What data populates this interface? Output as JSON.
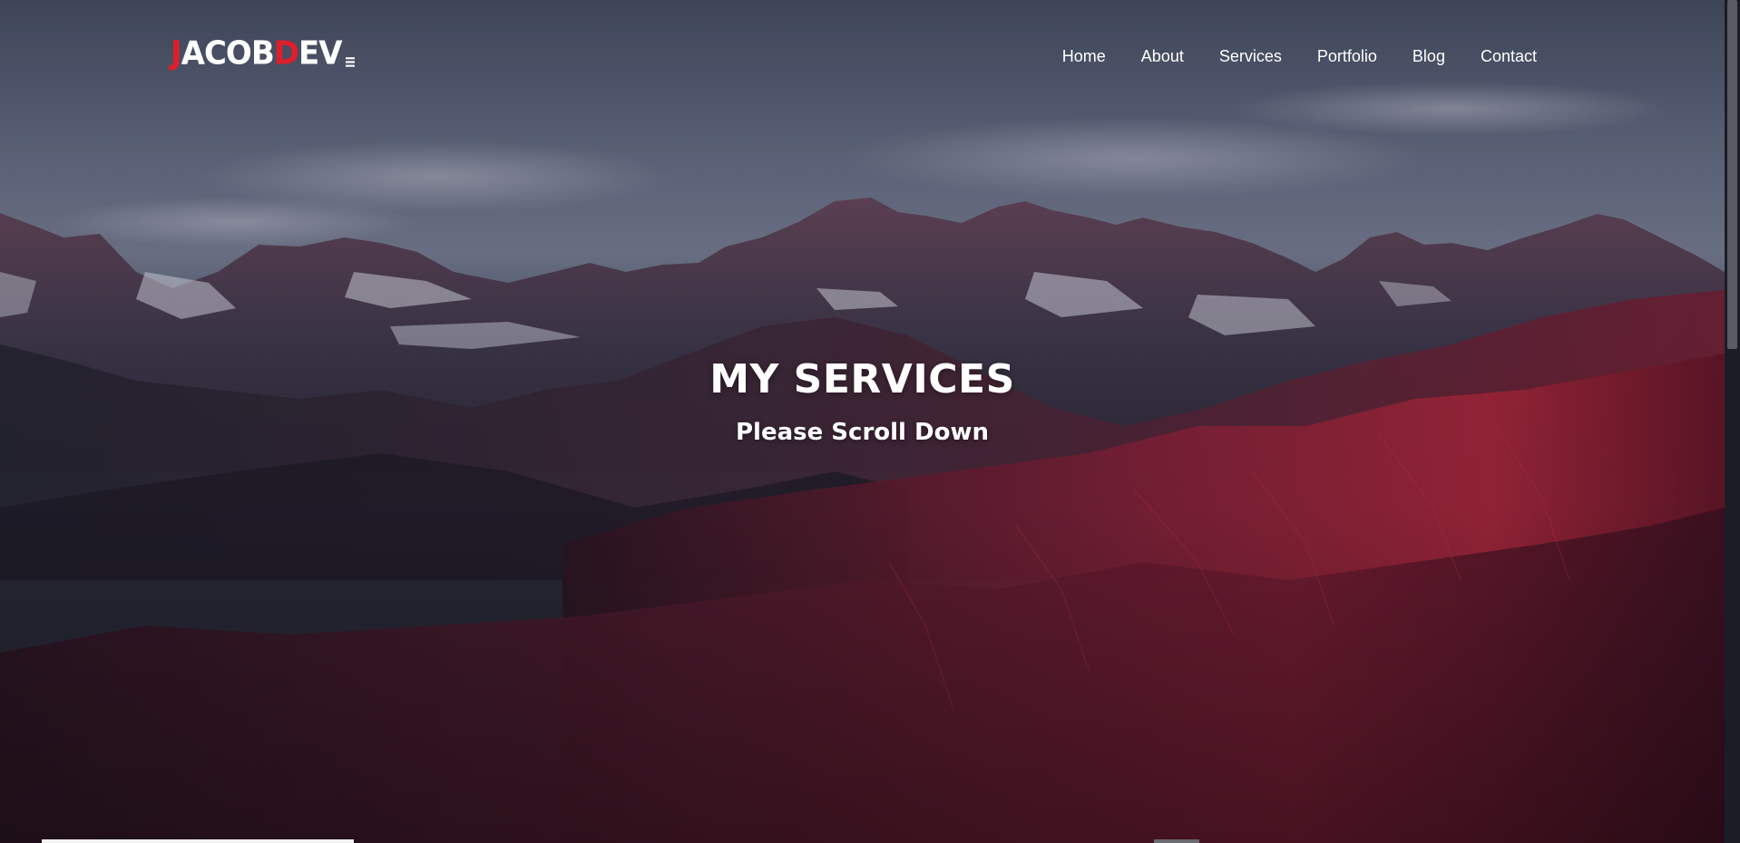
{
  "brand": {
    "logo_first": "J",
    "logo_mid1": "ACOB",
    "logo_accent": "D",
    "logo_rest": "EV",
    "accent_color": "#e01e2b"
  },
  "nav": {
    "items": [
      {
        "label": "Home"
      },
      {
        "label": "About"
      },
      {
        "label": "Services"
      },
      {
        "label": "Portfolio"
      },
      {
        "label": "Blog"
      },
      {
        "label": "Contact"
      }
    ]
  },
  "hero": {
    "title": "MY SERVICES",
    "subtitle": "Please Scroll Down",
    "background": "mountain landscape at dusk"
  },
  "icons": {
    "logo_menu": "menu-icon"
  }
}
